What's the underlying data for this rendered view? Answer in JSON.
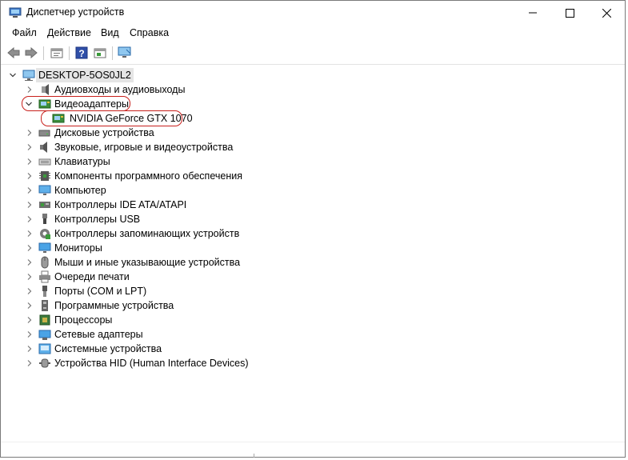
{
  "window": {
    "title": "Диспетчер устройств",
    "controls": {
      "minimize": "minimize",
      "maximize": "maximize",
      "close": "close"
    }
  },
  "menu": [
    "Файл",
    "Действие",
    "Вид",
    "Справка"
  ],
  "toolbar": [
    "back-arrow-icon",
    "forward-arrow-icon",
    "properties-icon",
    "help-icon",
    "update-driver-icon",
    "monitor-scan-icon"
  ],
  "tree": {
    "root": "DESKTOP-5OS0JL2",
    "categories": [
      {
        "label": "Аудиовходы и аудиовыходы",
        "icon": "audio-icon",
        "expanded": false
      },
      {
        "label": "Видеоадаптеры",
        "icon": "display-adapter-icon",
        "expanded": true,
        "highlighted": true,
        "children": [
          {
            "label": "NVIDIA GeForce GTX 1070",
            "icon": "gpu-icon",
            "highlighted": true
          }
        ]
      },
      {
        "label": "Дисковые устройства",
        "icon": "disk-icon",
        "expanded": false
      },
      {
        "label": "Звуковые, игровые и видеоустройства",
        "icon": "speaker-icon",
        "expanded": false
      },
      {
        "label": "Клавиатуры",
        "icon": "keyboard-icon",
        "expanded": false
      },
      {
        "label": "Компоненты программного обеспечения",
        "icon": "software-component-icon",
        "expanded": false
      },
      {
        "label": "Компьютер",
        "icon": "computer-icon",
        "expanded": false
      },
      {
        "label": "Контроллеры IDE ATA/ATAPI",
        "icon": "ide-controller-icon",
        "expanded": false
      },
      {
        "label": "Контроллеры USB",
        "icon": "usb-icon",
        "expanded": false
      },
      {
        "label": "Контроллеры запоминающих устройств",
        "icon": "storage-controller-icon",
        "expanded": false
      },
      {
        "label": "Мониторы",
        "icon": "monitor-icon",
        "expanded": false
      },
      {
        "label": "Мыши и иные указывающие устройства",
        "icon": "mouse-icon",
        "expanded": false
      },
      {
        "label": "Очереди печати",
        "icon": "printer-icon",
        "expanded": false
      },
      {
        "label": "Порты (COM и LPT)",
        "icon": "port-icon",
        "expanded": false
      },
      {
        "label": "Программные устройства",
        "icon": "software-device-icon",
        "expanded": false
      },
      {
        "label": "Процессоры",
        "icon": "processor-icon",
        "expanded": false
      },
      {
        "label": "Сетевые адаптеры",
        "icon": "network-adapter-icon",
        "expanded": false
      },
      {
        "label": "Системные устройства",
        "icon": "system-device-icon",
        "expanded": false
      },
      {
        "label": "Устройства HID (Human Interface Devices)",
        "icon": "hid-icon",
        "expanded": false
      }
    ]
  },
  "colors": {
    "highlight_oval": "#c8201c",
    "root_selection": "#e5e5e5"
  }
}
